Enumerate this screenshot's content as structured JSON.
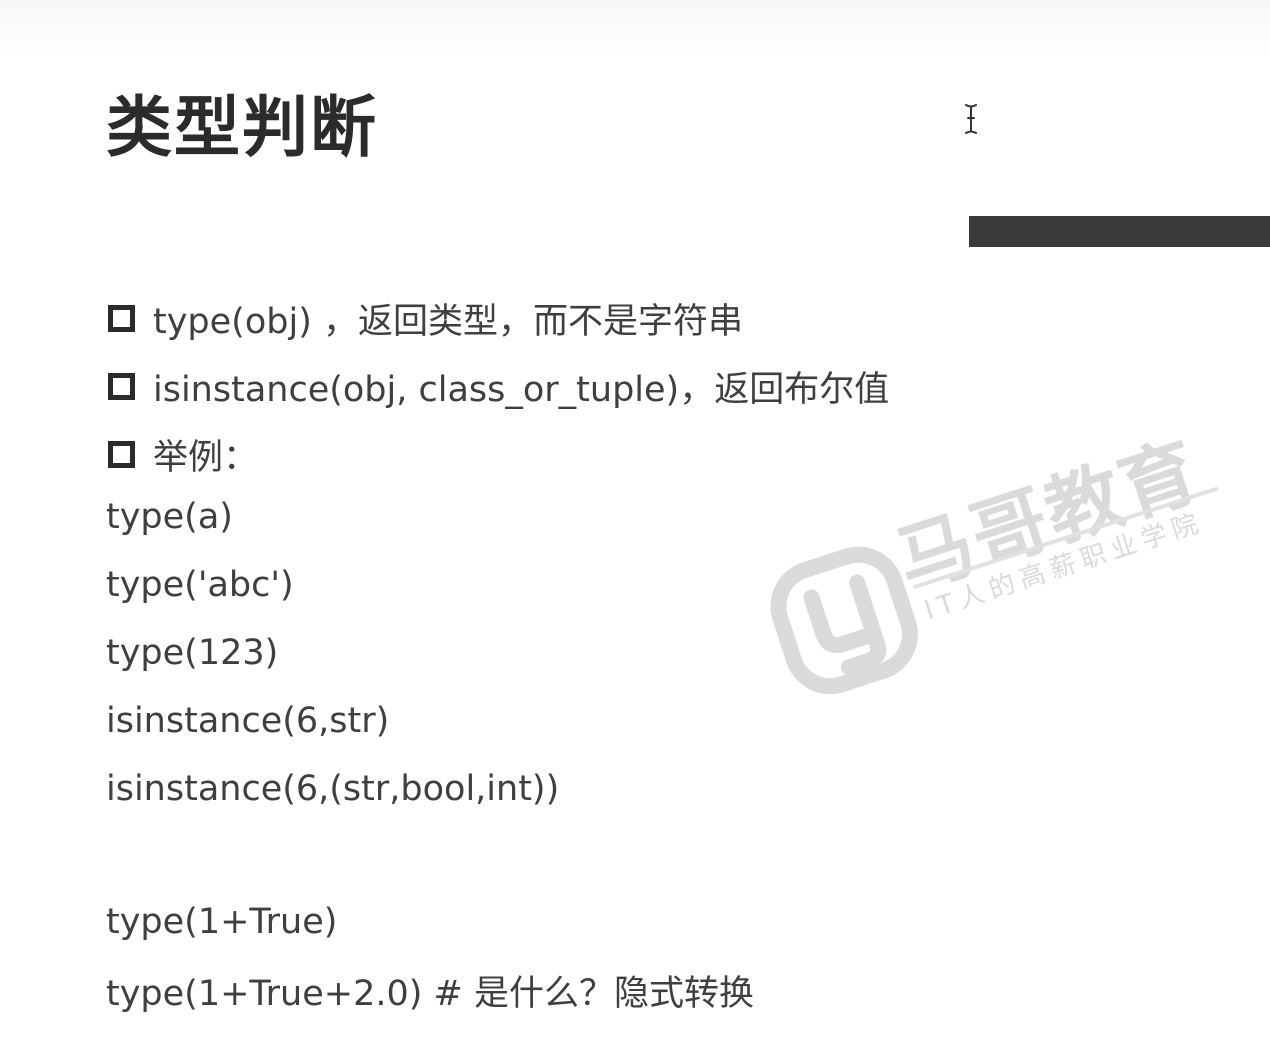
{
  "slide": {
    "title": "类型判断",
    "bullets": [
      "type(obj) ，返回类型，而不是字符串",
      "isinstance(obj, class_or_tuple)，返回布尔值",
      "举例："
    ],
    "code_lines": [
      "type(a)",
      "type('abc')",
      "type(123)",
      "isinstance(6,str)",
      "isinstance(6,(str,bool,int))"
    ],
    "code_lines_2": [
      "type(1+True)",
      "type(1+True+2.0) # 是什么？隐式转换"
    ]
  },
  "watermark": {
    "brand": "马哥教育",
    "slogan": "IT人的高薪职业学院"
  },
  "colors": {
    "background": "#ffffff",
    "title": "#2b2b2b",
    "body_text": "#3f3f3f",
    "accent_bar": "#3a3a3c",
    "watermark": "#bdbdbd"
  },
  "icons": {
    "cursor": "text-cursor-icon",
    "bullet": "hollow-square-bullet-icon",
    "logo": "magedu-logo-icon"
  }
}
